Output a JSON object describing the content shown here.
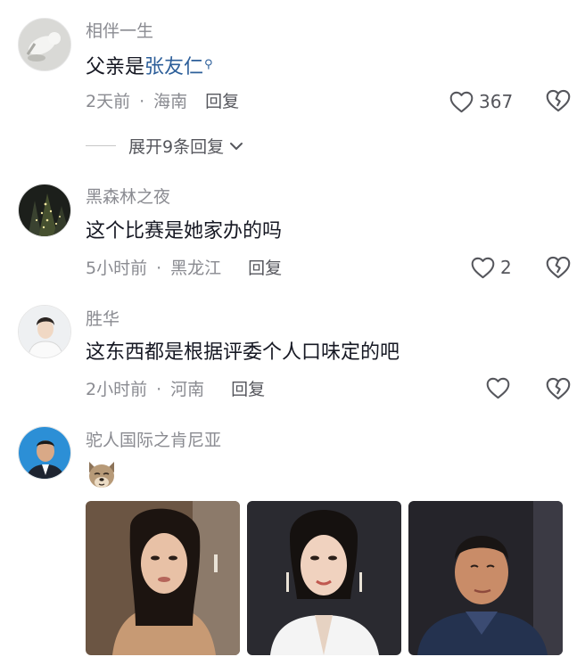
{
  "comments": [
    {
      "username": "相伴一生",
      "text_prefix": "父亲是",
      "mention": "张友仁",
      "time": "2天前",
      "location": "海南",
      "reply_label": "回复",
      "likes": "367",
      "expand_label": "展开9条回复"
    },
    {
      "username": "黑森林之夜",
      "text": "这个比赛是她家办的吗",
      "time": "5小时前",
      "location": "黑龙江",
      "reply_label": "回复",
      "likes": "2"
    },
    {
      "username": "胜华",
      "text": "这东西都是根据评委个人口味定的吧",
      "time": "2小时前",
      "location": "河南",
      "reply_label": "回复"
    },
    {
      "username": "驼人国际之肯尼亚",
      "emoji": "dog-face-emoji",
      "photo_count": 3
    }
  ],
  "separator": "·",
  "icons": {
    "like": "heart-outline-icon",
    "dislike": "broken-heart-icon",
    "expand": "chevron-down-icon",
    "mention_search": "search-icon"
  },
  "colors": {
    "mention": "#2d5f9a",
    "meta": "#8a8b91",
    "text": "#161823"
  }
}
